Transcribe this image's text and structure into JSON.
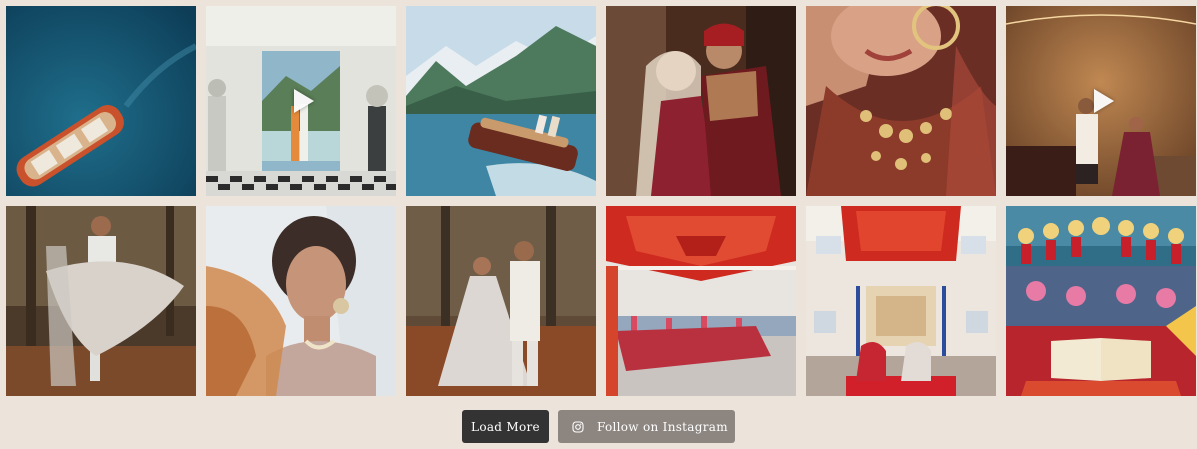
{
  "gallery": {
    "items": [
      {
        "subject": "aerial view of wooden speedboat on blue lake",
        "video": false
      },
      {
        "subject": "couple in villa doorway overlooking lake with statues",
        "video": true
      },
      {
        "subject": "wooden boat cruising on lake with mountains",
        "video": false
      },
      {
        "subject": "bride and groom in red and gold attire embracing",
        "video": false
      },
      {
        "subject": "close-up of bride with nose ring and gold jewellery",
        "video": false
      },
      {
        "subject": "couple seated in ornate golden room",
        "video": true
      },
      {
        "subject": "groom lifting bride in autumn forest",
        "video": false
      },
      {
        "subject": "bride portrait with veil through soft foreground",
        "video": false
      },
      {
        "subject": "couple standing in autumn woodland with garlands",
        "video": false
      },
      {
        "subject": "gurdwara hall with red canopy ceiling",
        "video": false
      },
      {
        "subject": "couple seated before palki under red canopy",
        "video": false
      },
      {
        "subject": "guru granth sahib with colourful guests behind",
        "video": false
      }
    ]
  },
  "actions": {
    "load_more_label": "Load More",
    "follow_label": "Follow on Instagram",
    "follow_icon": "instagram-icon"
  }
}
